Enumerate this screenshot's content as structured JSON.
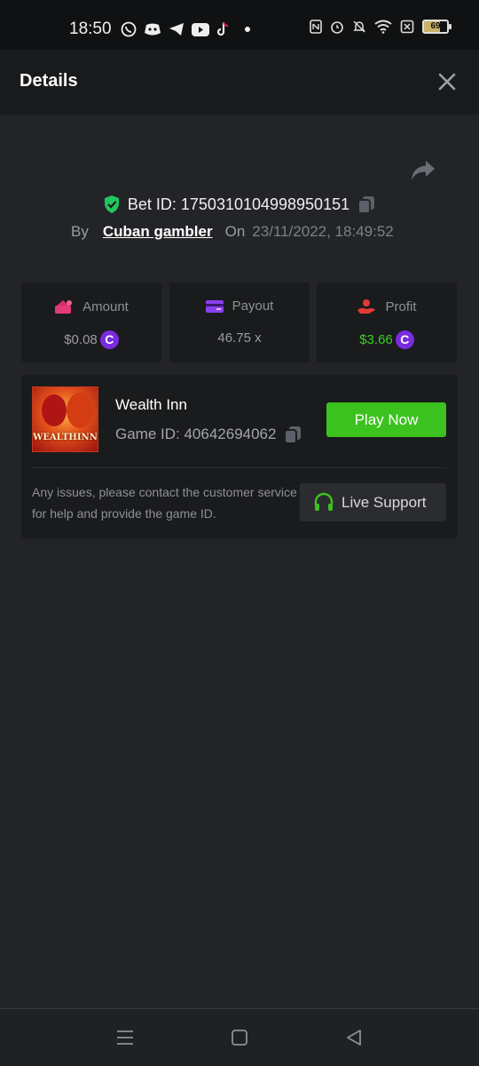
{
  "status_bar": {
    "time": "18:50",
    "battery": "69",
    "app_icons": [
      "whatsapp-icon",
      "discord-icon",
      "telegram-icon",
      "youtube-icon",
      "tiktok-icon"
    ],
    "system_icons": [
      "nfc-icon",
      "alarm-icon",
      "mute-icon",
      "wifi-icon",
      "sim-icon",
      "battery-icon"
    ]
  },
  "header": {
    "title": "Details"
  },
  "bet": {
    "bet_id": "Bet ID: 1750310104998950151",
    "by_label": "By",
    "user": "Cuban gambler",
    "on_label": "On",
    "datetime": "23/11/2022, 18:49:52"
  },
  "stats": {
    "amount": {
      "label": "Amount",
      "value": "$0.08",
      "coin": "C"
    },
    "payout": {
      "label": "Payout",
      "value": "46.75 x"
    },
    "profit": {
      "label": "Profit",
      "value": "$3.66",
      "coin": "C"
    }
  },
  "game": {
    "name": "Wealth Inn",
    "game_id": "Game ID: 40642694062",
    "thumb_text": "WEALTHINN",
    "play_label": "Play Now",
    "help_text": "Any issues, please contact the customer service for help and provide the game ID.",
    "support_label": "Live Support"
  },
  "colors": {
    "accent_green": "#3cc21e",
    "profit_green": "#3ccf24",
    "coin_purple": "#7a2be0",
    "shield_green": "#22c55e"
  }
}
